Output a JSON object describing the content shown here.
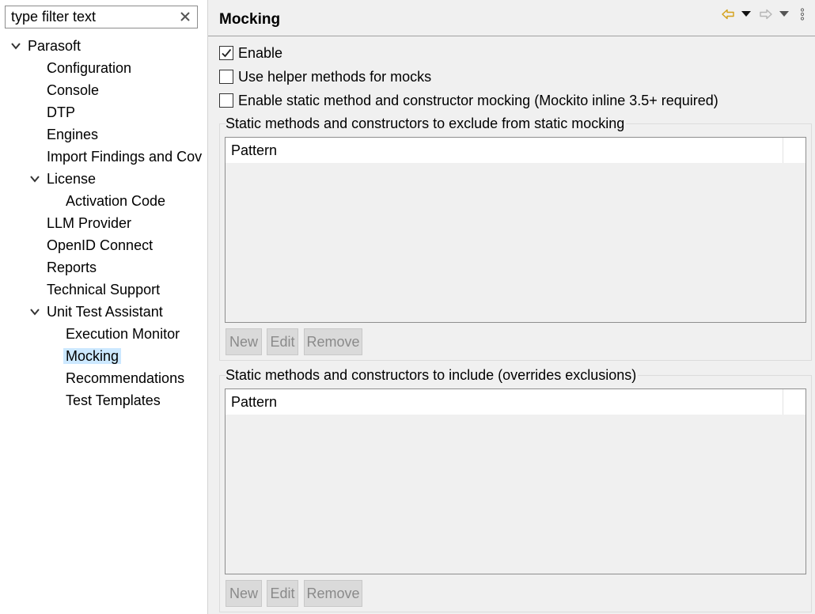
{
  "filter": {
    "placeholder": "type filter text"
  },
  "tree": {
    "items": [
      {
        "label": "Parasoft",
        "level": 0,
        "expanded": true
      },
      {
        "label": "Configuration",
        "level": 1
      },
      {
        "label": "Console",
        "level": 1
      },
      {
        "label": "DTP",
        "level": 1
      },
      {
        "label": "Engines",
        "level": 1
      },
      {
        "label": "Import Findings and Cov",
        "level": 1
      },
      {
        "label": "License",
        "level": 1,
        "expanded": true
      },
      {
        "label": "Activation Code",
        "level": 2
      },
      {
        "label": "LLM Provider",
        "level": 1
      },
      {
        "label": "OpenID Connect",
        "level": 1
      },
      {
        "label": "Reports",
        "level": 1
      },
      {
        "label": "Technical Support",
        "level": 1
      },
      {
        "label": "Unit Test Assistant",
        "level": 1,
        "expanded": true
      },
      {
        "label": "Execution Monitor",
        "level": 2
      },
      {
        "label": "Mocking",
        "level": 2,
        "selected": true
      },
      {
        "label": "Recommendations",
        "level": 2
      },
      {
        "label": "Test Templates",
        "level": 2
      }
    ]
  },
  "page": {
    "title": "Mocking",
    "nav": {
      "back_icon": "arrow-left-icon",
      "forward_icon": "arrow-right-icon",
      "menu_icon": "vertical-ellipsis-icon",
      "back_color": "#d4a017",
      "disabled_color": "#b5b5b5"
    },
    "options": {
      "enable": {
        "label": "Enable",
        "checked": true
      },
      "helper_methods": {
        "label": "Use helper methods for mocks",
        "checked": false
      },
      "static_mocking": {
        "label": "Enable static method and constructor mocking (Mockito inline 3.5+ required)",
        "checked": false
      }
    },
    "exclude_group": {
      "label": "Static methods and constructors to exclude from static mocking",
      "column": "Pattern",
      "buttons": {
        "new": "New",
        "edit": "Edit",
        "remove": "Remove"
      }
    },
    "include_group": {
      "label": "Static methods and constructors to include (overrides exclusions)",
      "column": "Pattern",
      "buttons": {
        "new": "New",
        "edit": "Edit",
        "remove": "Remove"
      }
    }
  },
  "colors": {
    "selection": "#cce8ff",
    "panel_bg": "#f0f0f0"
  }
}
